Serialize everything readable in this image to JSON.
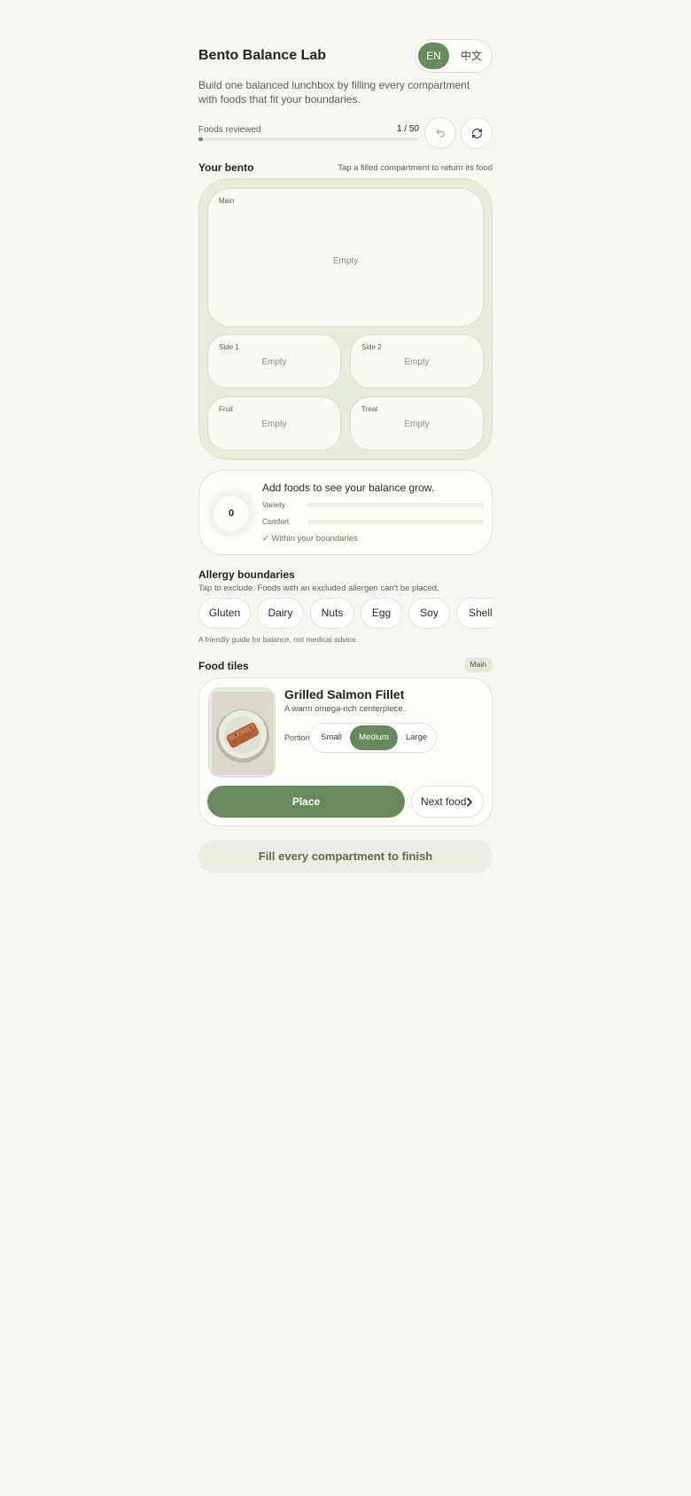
{
  "header": {
    "title": "Bento Balance Lab",
    "lang_options": [
      "EN",
      "中文"
    ],
    "lang_selected": "EN",
    "subtitle": "Build one balanced lunchbox by filling every compartment with foods that fit your boundaries."
  },
  "progress": {
    "label": "Foods reviewed",
    "count_text": "1 / 50",
    "current": 1,
    "total": 50,
    "undo_icon": "undo-icon",
    "refresh_icon": "refresh-icon"
  },
  "bento": {
    "title": "Your bento",
    "hint": "Tap a filled compartment to return its food",
    "compartments": [
      {
        "label": "Main",
        "state": "Empty"
      },
      {
        "label": "Side 1",
        "state": "Empty"
      },
      {
        "label": "Side 2",
        "state": "Empty"
      },
      {
        "label": "Fruit",
        "state": "Empty"
      },
      {
        "label": "Treat",
        "state": "Empty"
      }
    ]
  },
  "balance": {
    "score": "0",
    "message": "Add foods to see your balance grow.",
    "meters": [
      {
        "label": "Variety",
        "value": 0
      },
      {
        "label": "Comfort",
        "value": 0
      }
    ],
    "boundary_status": "✓ Within your boundaries"
  },
  "allergies": {
    "title": "Allergy boundaries",
    "subtitle": "Tap to exclude. Foods with an excluded allergen can't be placed.",
    "chips": [
      "Gluten",
      "Dairy",
      "Nuts",
      "Egg",
      "Soy",
      "Shellfish"
    ],
    "disclaimer": "A friendly guide for balance, not medical advice."
  },
  "food_tiles": {
    "title": "Food tiles",
    "badge": "Main",
    "card": {
      "name": "Grilled Salmon Fillet",
      "description": "A warm omega-rich centerpiece.",
      "portion_label": "Portion",
      "portions": [
        "Small",
        "Medium",
        "Large"
      ],
      "portion_selected": "Medium",
      "place_label": "Place",
      "next_label": "Next food"
    }
  },
  "finish_label": "Fill every compartment to finish",
  "colors": {
    "accent": "#668a5e",
    "background": "#f7f7f1",
    "bento_tray": "#e8ecdd"
  }
}
